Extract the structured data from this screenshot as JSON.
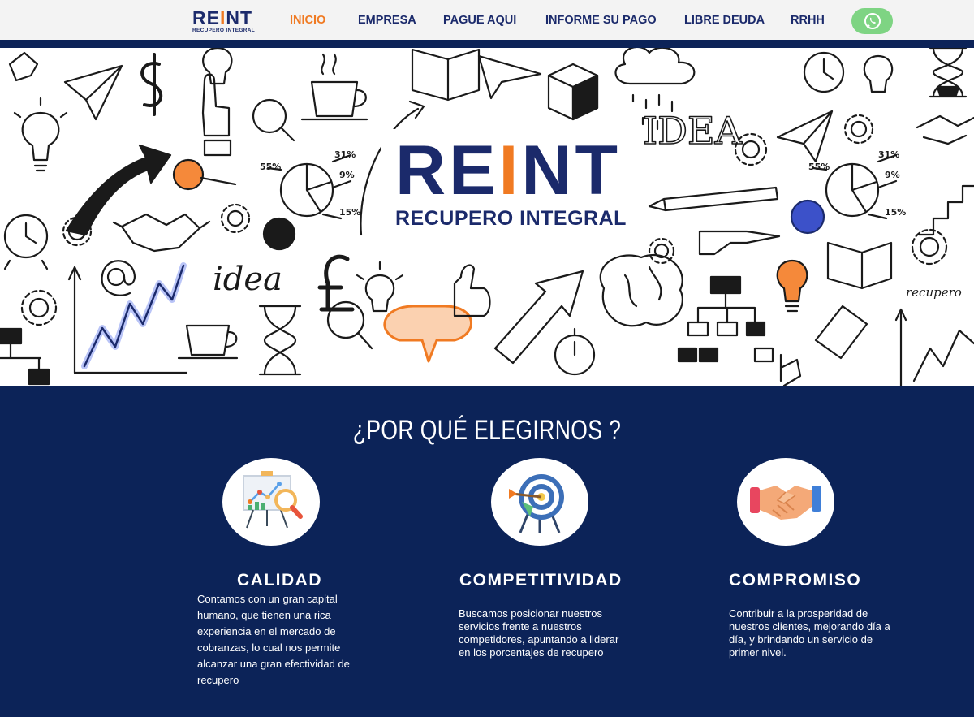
{
  "header": {
    "logo": {
      "brand_prefix": "RE",
      "brand_highlight": "I",
      "brand_suffix": "NT",
      "tagline": "RECUPERO INTEGRAL"
    },
    "nav": [
      {
        "label": "INICIO",
        "active": true
      },
      {
        "label": "EMPRESA",
        "active": false
      },
      {
        "label": "PAGUE AQUI",
        "active": false
      },
      {
        "label": "INFORME SU PAGO",
        "active": false
      },
      {
        "label": "LIBRE DEUDA",
        "active": false
      },
      {
        "label": "RRHH",
        "active": false
      }
    ],
    "whatsapp_icon": "whatsapp-icon"
  },
  "hero": {
    "brand_prefix": "RE",
    "brand_highlight": "I",
    "brand_suffix": "NT",
    "subtitle": "RECUPERO INTEGRAL",
    "doodle_texts": {
      "idea_top": "IDEA",
      "idea_left": "idea",
      "recupero": "recupero",
      "pct_55_left": "55%",
      "pct_31_left": "31%",
      "pct_9_left": "9%",
      "pct_15_left": "15%",
      "pct_55_right": "55%",
      "pct_31_right": "31%",
      "pct_9_right": "9%",
      "pct_15_right": "15%"
    }
  },
  "why": {
    "title": "¿POR QUÉ ELEGIRNOS ?",
    "features": [
      {
        "icon": "presentation-chart-icon",
        "title": "CALIDAD",
        "text": "Contamos con un gran capital humano, que tienen una rica experiencia en el mercado de cobranzas, lo cual nos permite alcanzar una gran efectividad de recupero"
      },
      {
        "icon": "target-dart-icon",
        "title": "COMPETITIVIDAD",
        "text": "Buscamos posicionar nuestros servicios frente a nuestros competidores, apuntando a liderar en los porcentajes de recupero"
      },
      {
        "icon": "handshake-icon",
        "title": "COMPROMISO",
        "text": "Contribuir a la prosperidad de nuestros clientes, mejorando día a día, y brindando un servicio de primer nivel."
      }
    ]
  },
  "colors": {
    "navy": "#0c2358",
    "brand_blue": "#1b2a6b",
    "orange": "#f07a22",
    "whatsapp_green": "#7ed483"
  }
}
